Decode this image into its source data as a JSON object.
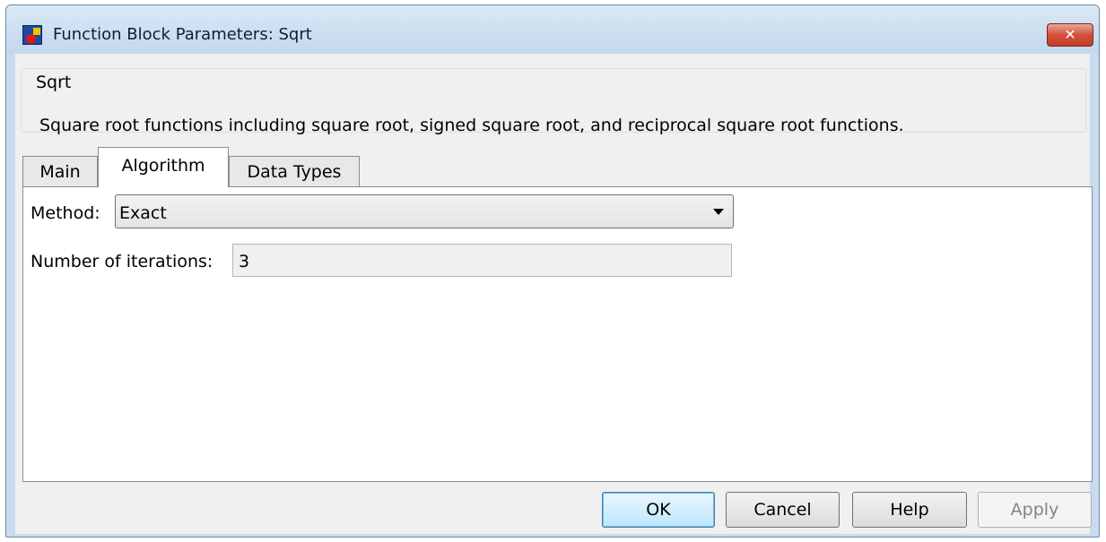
{
  "window": {
    "title": "Function Block Parameters: Sqrt",
    "close_glyph": "✕"
  },
  "block": {
    "name": "Sqrt",
    "description": "Square root functions including square root, signed square root, and reciprocal square root functions."
  },
  "tabs": [
    {
      "label": "Main",
      "active": false
    },
    {
      "label": "Algorithm",
      "active": true
    },
    {
      "label": "Data Types",
      "active": false
    }
  ],
  "algorithm": {
    "method_label": "Method:",
    "method_value": "Exact",
    "iterations_label": "Number of iterations:",
    "iterations_value": "3"
  },
  "buttons": {
    "ok": "OK",
    "cancel": "Cancel",
    "help": "Help",
    "apply": "Apply"
  }
}
